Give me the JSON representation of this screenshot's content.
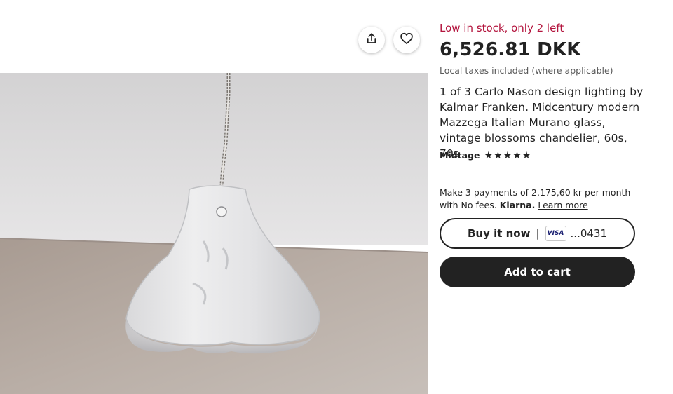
{
  "photo": {
    "alt": "Frosted Murano glass pendant lamp hanging from ceiling"
  },
  "actions": {
    "share_icon": "share-icon",
    "favorite_icon": "heart-icon"
  },
  "product": {
    "stock_notice": "Low in stock, only 2 left",
    "price": "6,526.81 DKK",
    "taxes_note": "Local taxes included (where applicable)",
    "title": "1 of 3 Carlo Nason design lighting by Kalmar Franken. Midcentury modern Mazzega Italian Murano glass, vintage blossoms chandelier, 60s, 70s",
    "shop_name": "Midtage",
    "rating_stars": 5
  },
  "payment": {
    "installment_text": "Make 3 payments of 2.175,60 kr per month with No fees.",
    "provider": "Klarna.",
    "learn_more": "Learn more"
  },
  "buttons": {
    "buy_now": "Buy it now",
    "separator": "|",
    "card_brand": "VISA",
    "card_digits": "...0431",
    "add_to_cart": "Add to cart"
  },
  "colors": {
    "stock": "#b3143d",
    "primary_button": "#222222"
  }
}
